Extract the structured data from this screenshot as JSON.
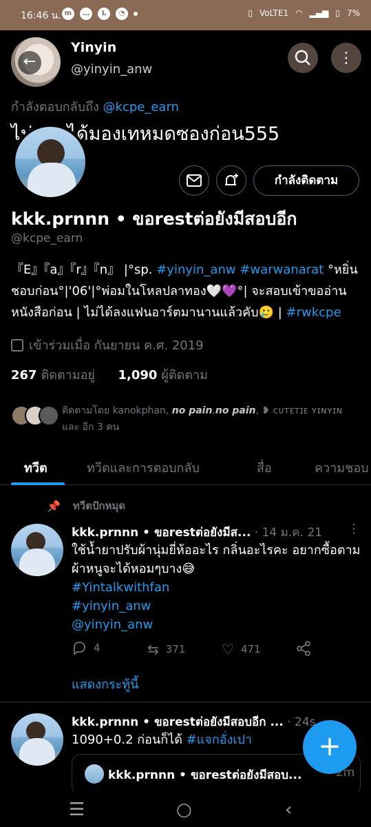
{
  "status_bar": {
    "time": "16:46 น.",
    "app_icons": [
      "messenger-icon",
      "chat-icon",
      "line-icon",
      "speed-icon",
      "dot-icon"
    ],
    "network": "VoLTE1",
    "battery": "7%"
  },
  "header": {
    "name": "Yinyin",
    "handle": "@yinyin_anw"
  },
  "reply_context": {
    "prefix": "กำลังตอบกลับถึง",
    "mention": "@kcpe_earn"
  },
  "background_tweet_text": "ไม่ค่อยได้มองเทหมดซองก่อน555",
  "profile": {
    "name": "kkk.prnnn • ขอrestต่อยังมีสอบอีก",
    "handle": "@kcpe_earn",
    "follow_button_label": "กำลังติดตาม",
    "bio_part1": "『E』『a』『r』『n』 |°sp. ",
    "bio_link1": "#yinyin_anw",
    "bio_link2": "#warwanarat",
    "bio_part2": " °หยิ่นชอบก่อน°|'06'|°พ่อมในโหลปลาทอง🤍💜°| จะสอบเข้าขออ่านหนังสือก่อน | ไม่ได้ลงแฟนอาร์ตมานานแล้วคับ🥲 | ",
    "bio_link3": "#rwkcpe",
    "joined": "เข้าร่วมเมื่อ กันยายน ค.ศ. 2019",
    "following_count": "267",
    "following_label": "ติดตามอยู่",
    "followers_count": "1,090",
    "followers_label": "ผู้ติดตาม",
    "followed_by_prefix": "ติดตามโดย kanokphan, ",
    "followed_by_bold1": "no pain",
    "followed_by_sep": ",",
    "followed_by_bold2": "no pain",
    "followed_by_suffix": ", ❥ ᴄᴜᴛᴇᴛɪᴇ ʏɪɴʏɪɴ และ อีก 3 คน"
  },
  "tabs": [
    "ทวีต",
    "ทวีตและการตอบกลับ",
    "สื่อ",
    "ความชอบ"
  ],
  "pinned_label": "ทวีตปักหมุด",
  "tweets": [
    {
      "author": "kkk.prnnn • ขอrestต่อยังมีส...",
      "time": " · 14 ม.ค. 21",
      "text": "ใช้น้ำยาปรับผ้านุ่มยี่ห้ออะไร กลิ่นอะไรคะ อยากซื้อตามผ้าหนูจะได้หอมๆบาง😅",
      "hashtag1": "#Yintalkwithfan",
      "hashtag2": "#yinyin_anw",
      "mention": "@yinyin_anw",
      "replies": "4",
      "retweets": "371",
      "likes": "471",
      "show_thread": "แสดงกระทู้นี้"
    },
    {
      "author": "kkk.prnnn • ขอrestต่อยังมีสอบอีก ...",
      "time": " · 24s",
      "text": "1090+0.2 ก่อนก็ได้ ",
      "hashtag": "#แจกอั่งเปา",
      "quote_author": "kkk.prnnn • ขอrestต่อยังมีสอบ...",
      "quote_time": "· 2m"
    }
  ]
}
